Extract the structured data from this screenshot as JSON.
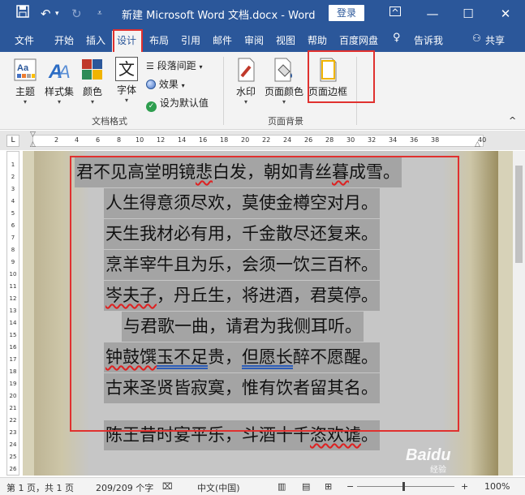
{
  "titlebar": {
    "title": "新建 Microsoft Word 文档.docx  -  Word",
    "login": "登录",
    "save_icon": "save-icon",
    "undo_icon": "undo-icon",
    "redo_icon": "redo-icon",
    "customize_icon": "customize-icon",
    "ribbon_display_icon": "ribbon-display-icon",
    "minimize": "—",
    "maximize": "☐",
    "close": "✕"
  },
  "tabs": [
    "文件",
    "开始",
    "插入",
    "设计",
    "布局",
    "引用",
    "邮件",
    "审阅",
    "视图",
    "帮助",
    "百度网盘",
    "告诉我",
    "共享"
  ],
  "active_tab_index": 3,
  "ribbon": {
    "themes": "主题",
    "style_set": "样式集",
    "colors": "颜色",
    "fonts": "字体",
    "font_icon_text": "文",
    "paragraph_spacing": "段落间距",
    "effects": "效果",
    "set_default": "设为默认值",
    "watermark": "水印",
    "page_color": "页面颜色",
    "page_borders": "页面边框",
    "group_doc_format": "文档格式",
    "group_page_bg": "页面背景",
    "collapse": "^"
  },
  "ruler": {
    "corner": "L",
    "marks": [
      "2",
      "4",
      "6",
      "8",
      "10",
      "12",
      "14",
      "16",
      "18",
      "20",
      "22",
      "24",
      "26",
      "28",
      "30",
      "32",
      "34",
      "36",
      "38",
      "40"
    ],
    "vmarks": [
      "1",
      "2",
      "3",
      "4",
      "5",
      "6",
      "7",
      "8",
      "9",
      "10",
      "11",
      "12",
      "13",
      "14",
      "15",
      "16",
      "17",
      "18",
      "19",
      "20",
      "21",
      "22",
      "23",
      "24",
      "25",
      "26"
    ]
  },
  "document": {
    "lines": [
      "君不见高堂明镜悲白发，朝如青丝暮成雪。",
      "人生得意须尽欢，莫使金樽空对月。",
      "天生我材必有用，千金散尽还复来。",
      "烹羊宰牛且为乐，会须一饮三百杯。",
      "岑夫子，丹丘生，将进酒，君莫停。",
      "与君歌一曲，请君为我侧耳听。",
      "钟鼓馔玉不足贵，但愿长醉不愿醒。",
      "古来圣贤皆寂寞，惟有饮者留其名。",
      "陈王昔时宴平乐，斗酒十千恣欢谑。"
    ],
    "line5_squiggle": "岑夫子",
    "line5_rest": "，丹丘生，将进酒，君莫停。",
    "line7_a": "钟鼓馔",
    "line7_b": "玉不足",
    "line7_c": "贵，",
    "line7_d": "但愿长",
    "line7_e": "醉不愿醒。",
    "line9_a": "陈王昔时宴平乐，斗酒十千",
    "line9_b": "恣欢谑",
    "line9_c": "。",
    "line1_a": "君不见高堂明镜",
    "line1_b": "悲",
    "line1_c": "白发，朝如青丝",
    "line1_d": "暮",
    "line1_e": "成雪。"
  },
  "statusbar": {
    "page": "第 1 页，共 1 页",
    "words": "209/209 个字",
    "lang": "中文(中国)",
    "zoom": "100%",
    "zoom_minus": "−",
    "zoom_plus": "+"
  },
  "watermark": {
    "brand": "Baidu",
    "sub": "经验"
  }
}
